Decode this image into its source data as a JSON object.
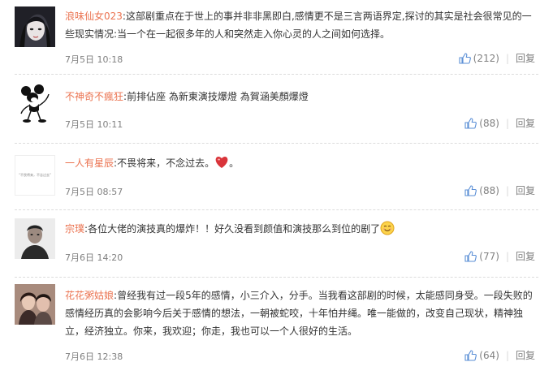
{
  "comments": [
    {
      "user": "浪味仙女023",
      "colon": ":",
      "text": "这部剧重点在于世上的事并非非黑即白,感情更不是三言两语界定,探讨的其实是社会很常见的一些现实情况:当一个在一起很多年的人和突然走入你心灵的人之间如何选择。",
      "time": "7月5日 10:18",
      "likes": "(212)",
      "reply": "回复",
      "avatar_icon": "dark-anime-portrait"
    },
    {
      "user": "不神奇不瘋狂",
      "colon": ":",
      "text": "前排佔座 為新東演技爆燈 為賀涵美顏爆燈",
      "time": "7月5日 10:11",
      "likes": "(88)",
      "reply": "回复",
      "avatar_icon": "mickey-mouse-sketch"
    },
    {
      "user": "一人有星辰",
      "colon": ":",
      "text_before": "不畏将来，不念过去。",
      "text_after": "。",
      "avatar_text": "“不畏将来，不念过去”",
      "time": "7月5日 08:57",
      "likes": "(88)",
      "reply": "回复",
      "emoji": "heart"
    },
    {
      "user": "宗璞",
      "colon": ":",
      "text_before": "各位大佬的演技真的爆炸！！好久没看到颜值和演技那么到位的剧了",
      "time": "7月6日 14:20",
      "likes": "(77)",
      "reply": "回复",
      "emoji": "smiling-face"
    },
    {
      "user": "花花粥姑娘",
      "colon": ":",
      "text": "曾经我有过一段5年的感情，小三介入，分手。当我看这部剧的时候，太能感同身受。一段失败的感情经历真的会影响今后关于感情的想法，一朝被蛇咬，十年怕井绳。唯一能做的，改变自己现状，精神独立，经济独立。你来，我欢迎；你走，我也可以一个人很好的生活。",
      "time": "7月6日 12:38",
      "likes": "(64)",
      "reply": "回复",
      "avatar_icon": "couple-photo"
    }
  ],
  "colors": {
    "username": "#eb7350",
    "meta": "#808080",
    "like_icon": "#5b8fd6"
  }
}
